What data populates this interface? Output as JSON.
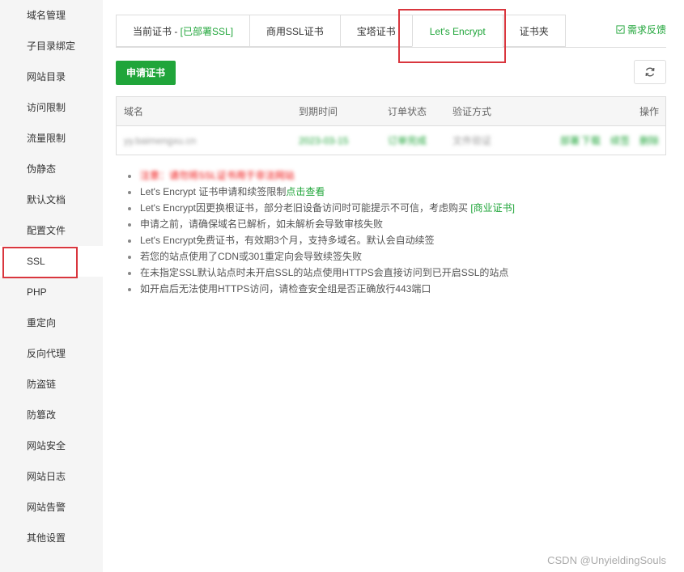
{
  "sidebar": {
    "items": [
      {
        "label": "域名管理"
      },
      {
        "label": "子目录绑定"
      },
      {
        "label": "网站目录"
      },
      {
        "label": "访问限制"
      },
      {
        "label": "流量限制"
      },
      {
        "label": "伪静态"
      },
      {
        "label": "默认文档"
      },
      {
        "label": "配置文件"
      },
      {
        "label": "SSL"
      },
      {
        "label": "PHP"
      },
      {
        "label": "重定向"
      },
      {
        "label": "反向代理"
      },
      {
        "label": "防盗链"
      },
      {
        "label": "防篡改"
      },
      {
        "label": "网站安全"
      },
      {
        "label": "网站日志"
      },
      {
        "label": "网站告警"
      },
      {
        "label": "其他设置"
      }
    ],
    "active": "SSL"
  },
  "tabs": {
    "current_prefix": "当前证书 - ",
    "current_status": "[已部署SSL]",
    "commercial": "商用SSL证书",
    "baota": "宝塔证书",
    "letsencrypt": "Let's Encrypt",
    "folder": "证书夹"
  },
  "feedback": "需求反馈",
  "apply_button": "申请证书",
  "table": {
    "headers": {
      "domain": "域名",
      "expire": "到期时间",
      "status": "订单状态",
      "verify": "验证方式",
      "actions": "操作"
    },
    "row": {
      "domain": "yy.baimengxu.cn",
      "expire": "2023-03-15",
      "status": "订单完成",
      "verify": "文件验证",
      "actions": [
        "部署",
        "下载",
        "续签",
        "删除"
      ]
    }
  },
  "notes": {
    "warning": "注意：请勿将SSL证书用于非法网站",
    "n1_text": "Let's Encrypt 证书申请和续签限制",
    "n1_link": "点击查看",
    "n2_text": "Let's Encrypt因更换根证书，部分老旧设备访问时可能提示不可信，考虑购买 ",
    "n2_link": "[商业证书]",
    "n3": "申请之前，请确保域名已解析，如未解析会导致审核失败",
    "n4": "Let's Encrypt免费证书，有效期3个月，支持多域名。默认会自动续签",
    "n5": "若您的站点使用了CDN或301重定向会导致续签失败",
    "n6": "在未指定SSL默认站点时未开启SSL的站点使用HTTPS会直接访问到已开启SSL的站点",
    "n7": "如开启后无法使用HTTPS访问，请检查安全组是否正确放行443端口"
  },
  "watermark": "CSDN @UnyieldingSouls",
  "colors": {
    "accent": "#20a53a",
    "highlight": "#d9363e",
    "warning": "#ef0808"
  }
}
